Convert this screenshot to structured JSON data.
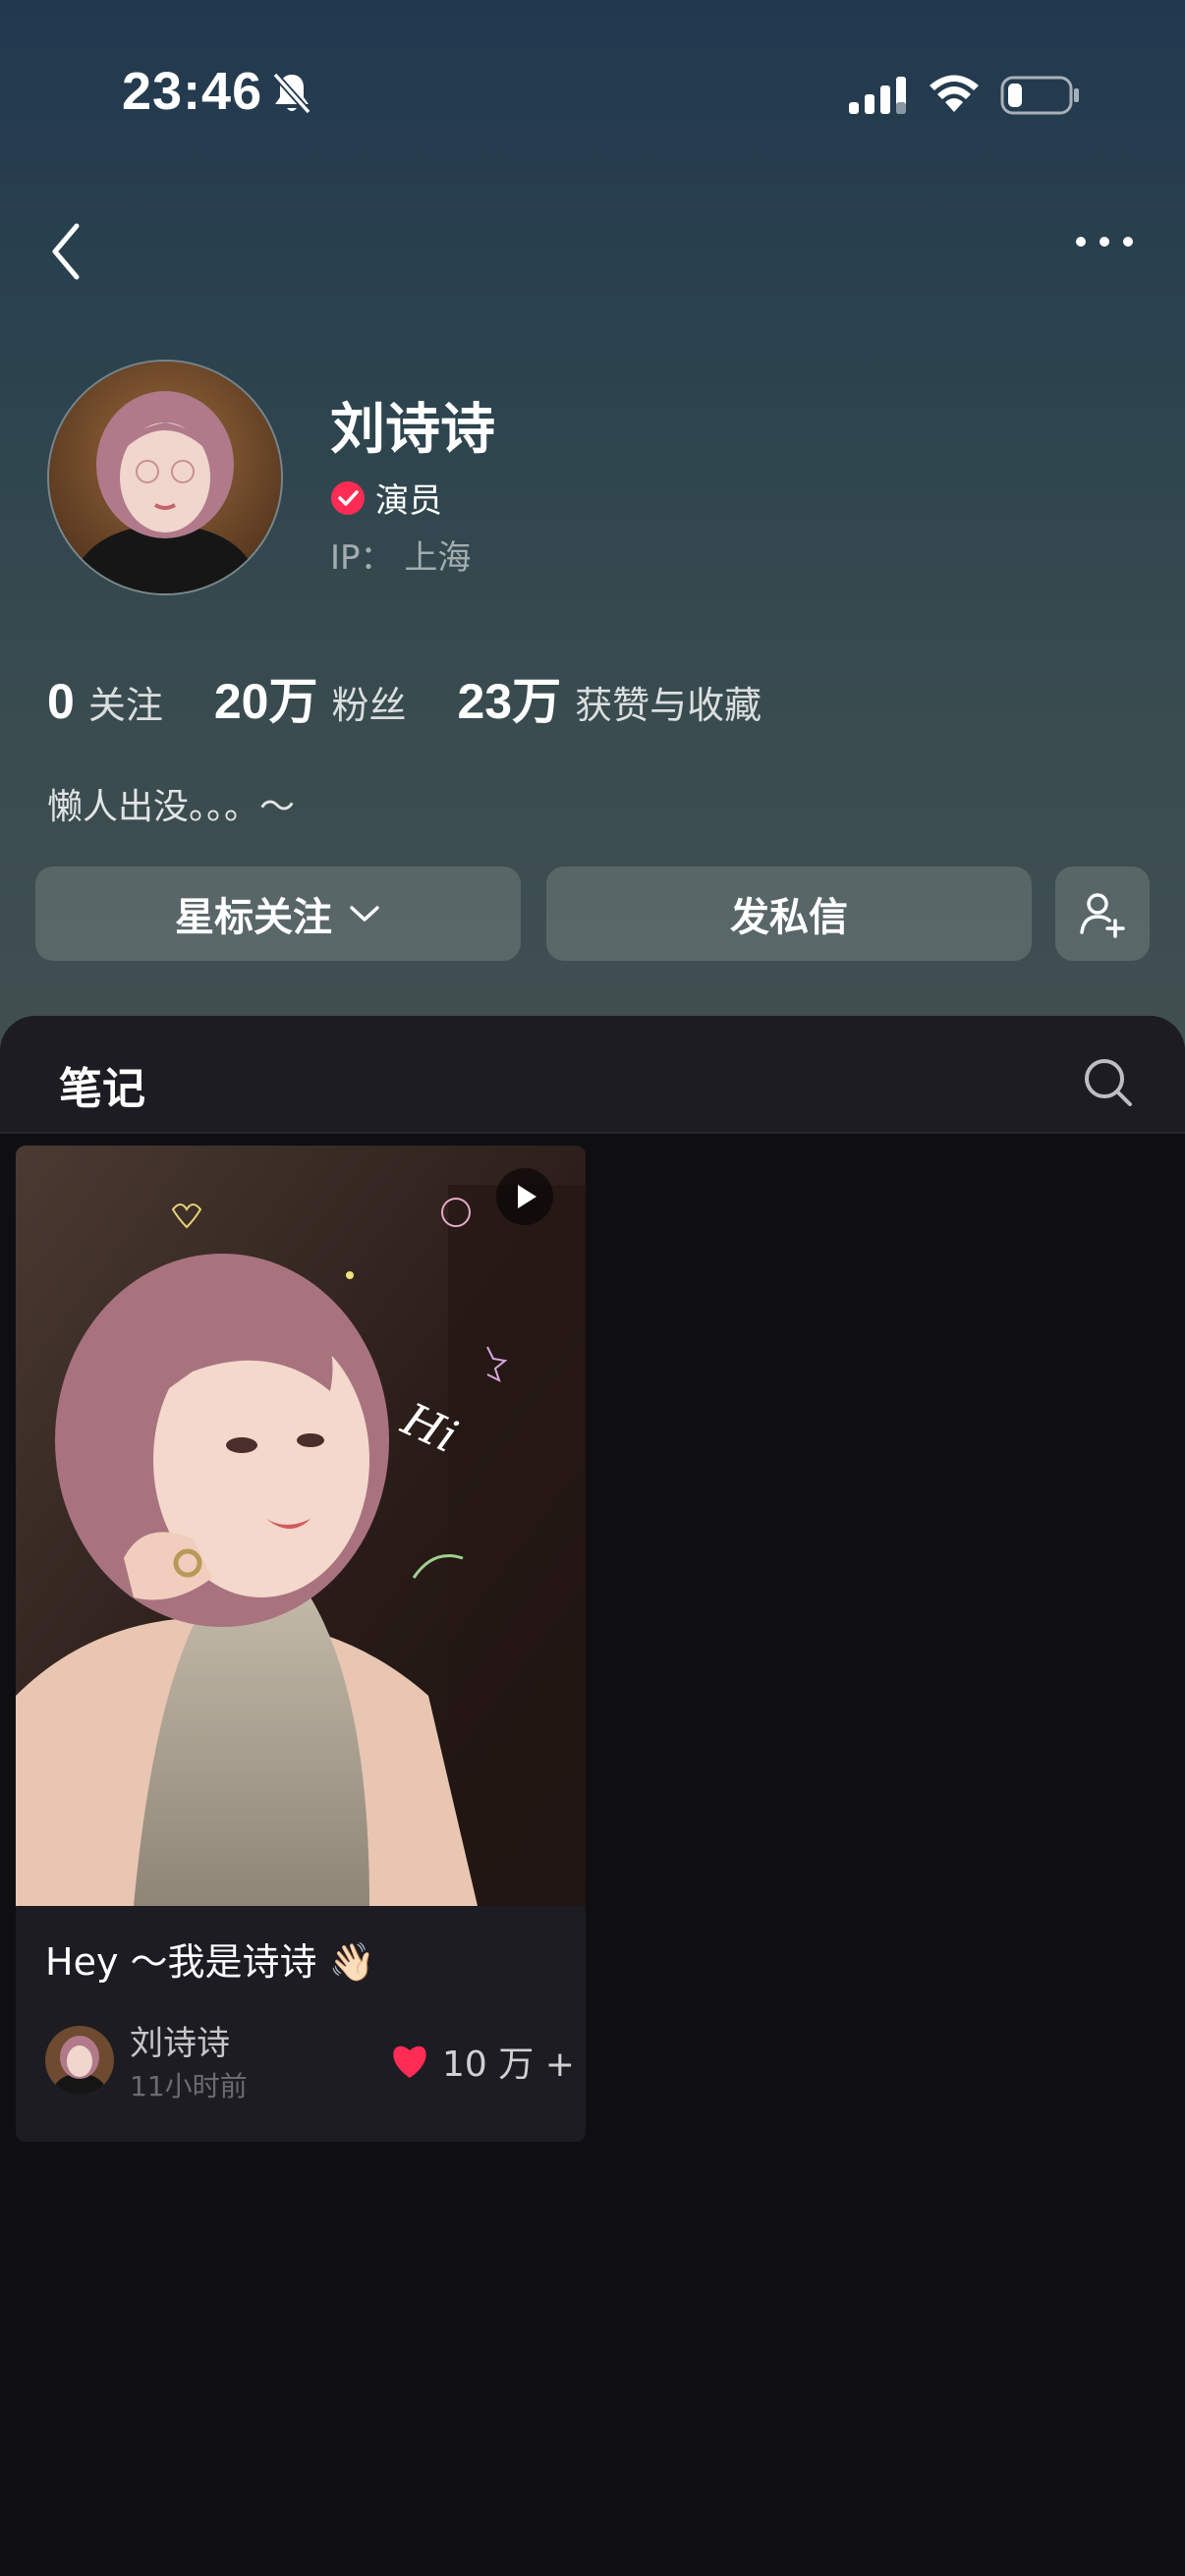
{
  "status_bar": {
    "time": "23:46"
  },
  "profile": {
    "name": "刘诗诗",
    "verified_label": "演员",
    "ip": "IP：  上海",
    "bio": "懒人出没。。。～"
  },
  "stats": [
    {
      "value": "0",
      "label": "关注"
    },
    {
      "value": "20万",
      "label": "粉丝"
    },
    {
      "value": "23万",
      "label": "获赞与收藏"
    }
  ],
  "actions": {
    "star_follow": "星标关注",
    "message": "发私信"
  },
  "tabs": {
    "notes": "笔记"
  },
  "notes": [
    {
      "title": "Hey ～我是诗诗 👋🏻",
      "author": "刘诗诗",
      "time": "11小时前",
      "likes": "10 万 +"
    }
  ],
  "colors": {
    "accent_red": "#fe2c55",
    "header_top": "#22384f",
    "header_bottom": "#414f50",
    "panel_bg": "#0f0f11",
    "card_bg": "#1c1c22"
  }
}
